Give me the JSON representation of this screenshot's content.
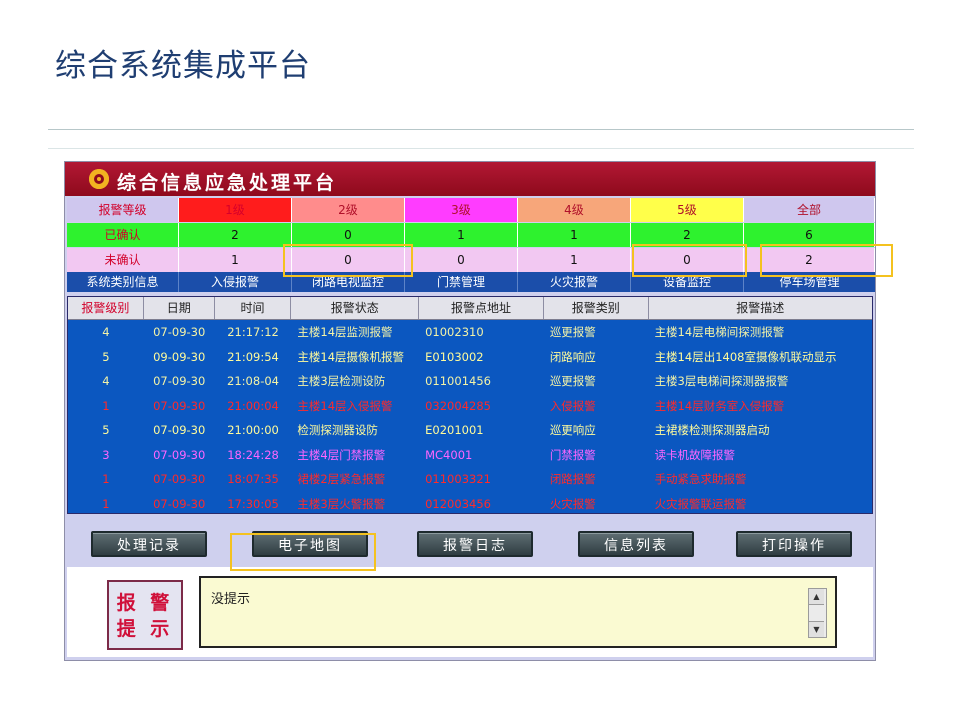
{
  "slide": {
    "title": "综合系统集成平台"
  },
  "app": {
    "title": "综合信息应急处理平台",
    "level_grid": {
      "header": [
        "报警等级",
        "1级",
        "2级",
        "3级",
        "4级",
        "5级",
        "全部"
      ],
      "confirmed": [
        "已确认",
        "2",
        "0",
        "1",
        "1",
        "2",
        "6"
      ],
      "unconfirmed": [
        "未确认",
        "1",
        "0",
        "0",
        "1",
        "0",
        "2"
      ],
      "header_colors": [
        "#cfc7ee",
        "#ff1c1c",
        "#ff8c8c",
        "#ff3cff",
        "#f7a67a",
        "#ffff4a",
        "#cfc7ee"
      ],
      "confirmed_color": "#2ef22e",
      "unconfirmed_color": "#f2c8f2"
    },
    "nav": [
      "系统类别信息",
      "入侵报警",
      "闭路电视监控",
      "门禁管理",
      "火灾报警",
      "设备监控",
      "停车场管理"
    ],
    "table": {
      "columns": [
        "报警级别",
        "日期",
        "时间",
        "报警状态",
        "报警点地址",
        "报警类别",
        "报警描述"
      ],
      "rows": [
        {
          "cells": [
            "4",
            "07-09-30",
            "21:17:12",
            "主楼14层监测报警",
            "01002310",
            "巡更报警",
            "主楼14层电梯间探测报警"
          ],
          "color": "#f3f3a8"
        },
        {
          "cells": [
            "5",
            "09-09-30",
            "21:09:54",
            "主楼14层摄像机报警",
            "E0103002",
            "闭路响应",
            "主楼14层出1408室摄像机联动显示"
          ],
          "color": "#fffb9c"
        },
        {
          "cells": [
            "4",
            "07-09-30",
            "21:08-04",
            "主楼3层检测设防",
            "011001456",
            "巡更报警",
            "主楼3层电梯间探测器报警"
          ],
          "color": "#f3f3a8"
        },
        {
          "cells": [
            "1",
            "07-09-30",
            "21:00:04",
            "主楼14层入侵报警",
            "032004285",
            "入侵报警",
            "主楼14层财务室入侵报警"
          ],
          "color": "#ff2a2a"
        },
        {
          "cells": [
            "5",
            "07-09-30",
            "21:00:00",
            "检测探测器设防",
            "E0201001",
            "巡更响应",
            "主裙楼检测探测器启动"
          ],
          "color": "#fffb9c"
        },
        {
          "cells": [
            "3",
            "07-09-30",
            "18:24:28",
            "主楼4层门禁报警",
            "MC4001",
            "门禁报警",
            "读卡机故障报警"
          ],
          "color": "#ff66ff"
        },
        {
          "cells": [
            "1",
            "07-09-30",
            "18:07:35",
            "裙楼2层紧急报警",
            "011003321",
            "闭路报警",
            "手动紧急求助报警"
          ],
          "color": "#ff2a2a"
        },
        {
          "cells": [
            "1",
            "07-09-30",
            "17:30:05",
            "主楼3层火警报警",
            "012003456",
            "火灾报警",
            "火灾报警联运报警"
          ],
          "color": "#ff2a2a"
        }
      ]
    },
    "buttons": [
      "处理记录",
      "电子地图",
      "报警日志",
      "信息列表",
      "打印操作"
    ],
    "prompt": {
      "badge_line1": "报 警",
      "badge_line2": "提 示",
      "text": "没提示"
    }
  }
}
